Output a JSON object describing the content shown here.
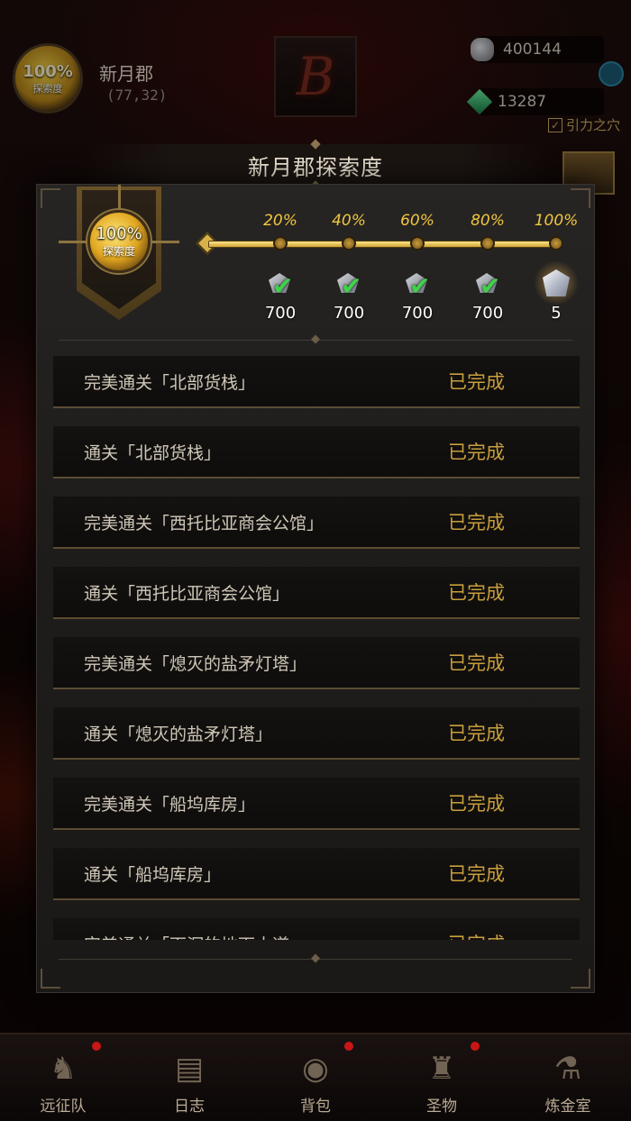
{
  "hud": {
    "region_progress": "100%",
    "region_progress_label": "探索度",
    "region_name": "新月郡",
    "region_coords": "(77,32)",
    "silver": "400144",
    "gems": "13287",
    "gravity_label": "引力之穴"
  },
  "modal": {
    "title": "新月郡探索度",
    "emblem_pct": "100%",
    "emblem_label": "探索度",
    "progress_fraction": 1.0,
    "milestones": [
      {
        "pct": "20%",
        "reward": "700",
        "icon": "silver-ore-icon",
        "claimed": true
      },
      {
        "pct": "40%",
        "reward": "700",
        "icon": "silver-ore-icon",
        "claimed": true
      },
      {
        "pct": "60%",
        "reward": "700",
        "icon": "silver-ore-icon",
        "claimed": true
      },
      {
        "pct": "80%",
        "reward": "700",
        "icon": "silver-ore-icon",
        "claimed": true
      },
      {
        "pct": "100%",
        "reward": "5",
        "icon": "crystal-icon",
        "claimed": false
      }
    ],
    "tasks": [
      {
        "name": "完美通关「北部货栈」",
        "status": "已完成"
      },
      {
        "name": "通关「北部货栈」",
        "status": "已完成"
      },
      {
        "name": "完美通关「西托比亚商会公馆」",
        "status": "已完成"
      },
      {
        "name": "通关「西托比亚商会公馆」",
        "status": "已完成"
      },
      {
        "name": "完美通关「熄灭的盐矛灯塔」",
        "status": "已完成"
      },
      {
        "name": "通关「熄灭的盐矛灯塔」",
        "status": "已完成"
      },
      {
        "name": "完美通关「船坞库房」",
        "status": "已完成"
      },
      {
        "name": "通关「船坞库房」",
        "status": "已完成"
      },
      {
        "name": "完美通关「下沉的地下水道」",
        "status": "已完成"
      }
    ]
  },
  "nav": [
    {
      "label": "远征队",
      "icon": "viking-helmet-icon",
      "dot": true
    },
    {
      "label": "日志",
      "icon": "journal-icon",
      "dot": false
    },
    {
      "label": "背包",
      "icon": "bag-icon",
      "dot": true
    },
    {
      "label": "圣物",
      "icon": "relic-icon",
      "dot": true
    },
    {
      "label": "炼金室",
      "icon": "alchemy-icon",
      "dot": false
    }
  ],
  "colors": {
    "gold": "#c89f3d",
    "accent_pct": "#f0c640",
    "claimed_tick": "#3fd24a"
  }
}
